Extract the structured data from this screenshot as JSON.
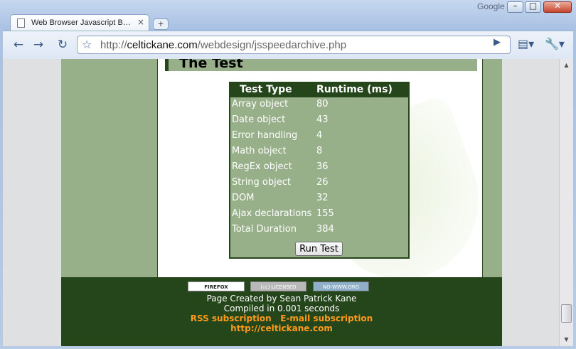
{
  "window": {
    "brand": "Google",
    "minimize_glyph": "–",
    "maximize_glyph": "□",
    "close_glyph": "✕"
  },
  "tab": {
    "title": "Web Browser Javascript B…",
    "close_glyph": "×",
    "new_tab_glyph": "+"
  },
  "toolbar": {
    "back_glyph": "←",
    "forward_glyph": "→",
    "reload_glyph": "↻",
    "star_glyph": "☆",
    "url_scheme": "http://",
    "url_host": "celtickane.com",
    "url_path": "/webdesign/jsspeedarchive.php",
    "go_glyph": "▶",
    "page_menu_glyph": "▤▾",
    "wrench_glyph": "🔧▾"
  },
  "page": {
    "heading": "The Test",
    "table": {
      "headers": [
        "Test Type",
        "Runtime (ms)"
      ],
      "rows": [
        [
          "Array object",
          "80"
        ],
        [
          "Date object",
          "43"
        ],
        [
          "Error handling",
          "4"
        ],
        [
          "Math object",
          "8"
        ],
        [
          "RegEx object",
          "36"
        ],
        [
          "String object",
          "26"
        ],
        [
          "DOM",
          "32"
        ],
        [
          "Ajax declarations",
          "155"
        ],
        [
          "Total Duration",
          "384"
        ]
      ],
      "run_button": "Run Test"
    },
    "footer": {
      "badges": {
        "firefox": "FIREFOX",
        "cc": "(cc) LICENSED",
        "nowww": "NO-WWW.ORG"
      },
      "created_by": "Page Created by Sean Patrick Kane",
      "compiled": "Compiled in 0.001 seconds",
      "rss": "RSS subscription",
      "email": "E-mail subscription",
      "site_link": "http://celtickane.com"
    }
  },
  "colors": {
    "dark_green": "#25461a",
    "sage": "#98b08a",
    "link_orange": "#ff9a1c"
  }
}
